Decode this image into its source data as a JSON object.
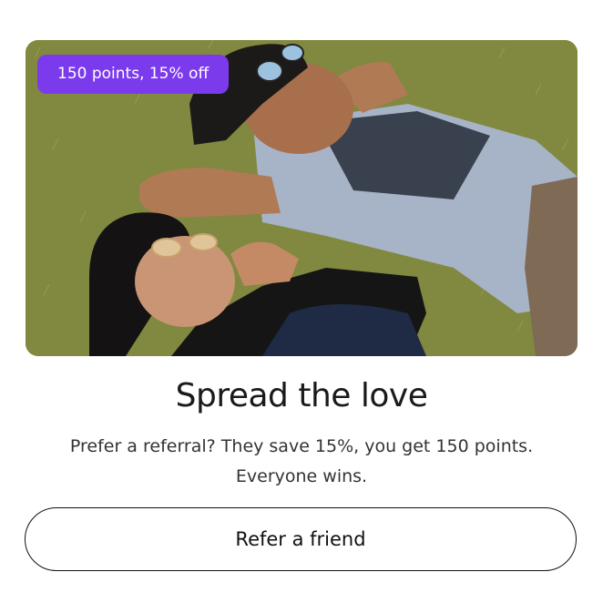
{
  "promo": {
    "badge": "150 points, 15% off",
    "title": "Spread the love",
    "description_line1": "Prefer a referral? They save 15%, you get 150 points.",
    "description_line2": "Everyone wins.",
    "cta_label": "Refer a friend"
  },
  "colors": {
    "badge_bg": "#7c3aed",
    "text": "#1a1a1a",
    "button_border": "#111111"
  }
}
